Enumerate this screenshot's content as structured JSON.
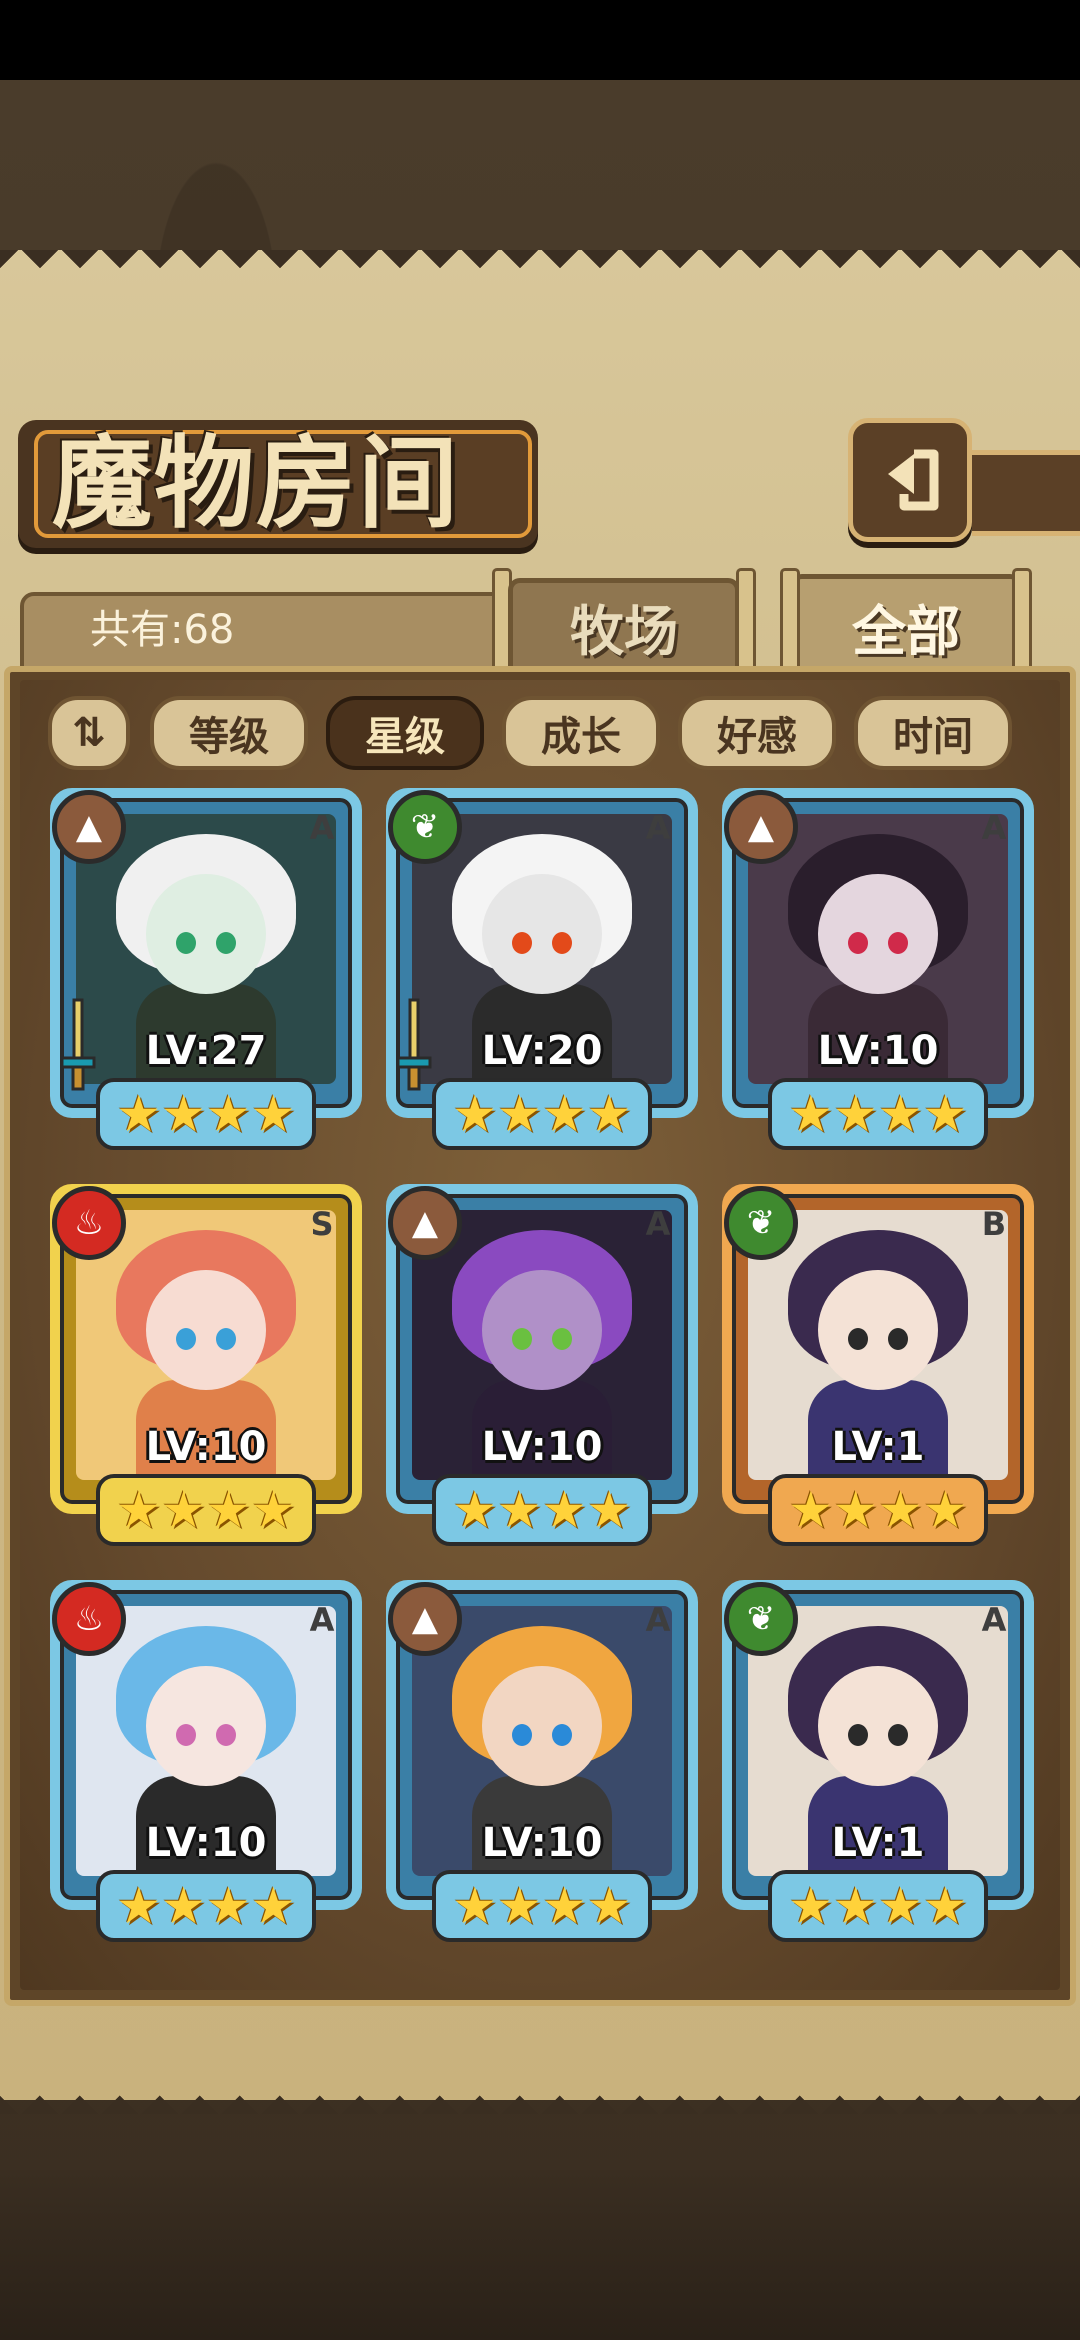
{
  "header": {
    "title": "魔物房间",
    "back_icon": "back-arrow-icon"
  },
  "tabs": {
    "count_label": "共有:68",
    "items": [
      {
        "label": "牧场",
        "active": false
      },
      {
        "label": "全部",
        "active": true
      }
    ]
  },
  "sort": {
    "order_icon": "sort-order-icon",
    "buttons": [
      {
        "label": "等级",
        "active": false
      },
      {
        "label": "星级",
        "active": true
      },
      {
        "label": "成长",
        "active": false
      },
      {
        "label": "好感",
        "active": false
      },
      {
        "label": "时间",
        "active": false
      }
    ]
  },
  "monsters": [
    {
      "level": "LV:27",
      "rank": "A",
      "element": "earth",
      "frame": "blue",
      "stars": 4,
      "equipped": true
    },
    {
      "level": "LV:20",
      "rank": "A",
      "element": "wood",
      "frame": "blue",
      "stars": 4,
      "equipped": true
    },
    {
      "level": "LV:10",
      "rank": "A",
      "element": "earth",
      "frame": "blue",
      "stars": 4,
      "equipped": false
    },
    {
      "level": "LV:10",
      "rank": "S",
      "element": "fire",
      "frame": "gold",
      "stars": 4,
      "equipped": false
    },
    {
      "level": "LV:10",
      "rank": "A",
      "element": "earth",
      "frame": "blue",
      "stars": 4,
      "equipped": false
    },
    {
      "level": "LV:1",
      "rank": "B",
      "element": "wood",
      "frame": "orange",
      "stars": 4,
      "equipped": false
    },
    {
      "level": "LV:10",
      "rank": "A",
      "element": "fire",
      "frame": "blue",
      "stars": 4,
      "equipped": false
    },
    {
      "level": "LV:10",
      "rank": "A",
      "element": "earth",
      "frame": "blue",
      "stars": 4,
      "equipped": false
    },
    {
      "level": "LV:1",
      "rank": "A",
      "element": "wood",
      "frame": "blue",
      "stars": 4,
      "equipped": false
    }
  ],
  "colors": {
    "parchment": "#cdb987",
    "panel": "#5e4528",
    "frame_blue": "#7cc8e4",
    "frame_gold": "#f1d24d",
    "frame_orange": "#f0a850",
    "star": "#ffd23a"
  }
}
